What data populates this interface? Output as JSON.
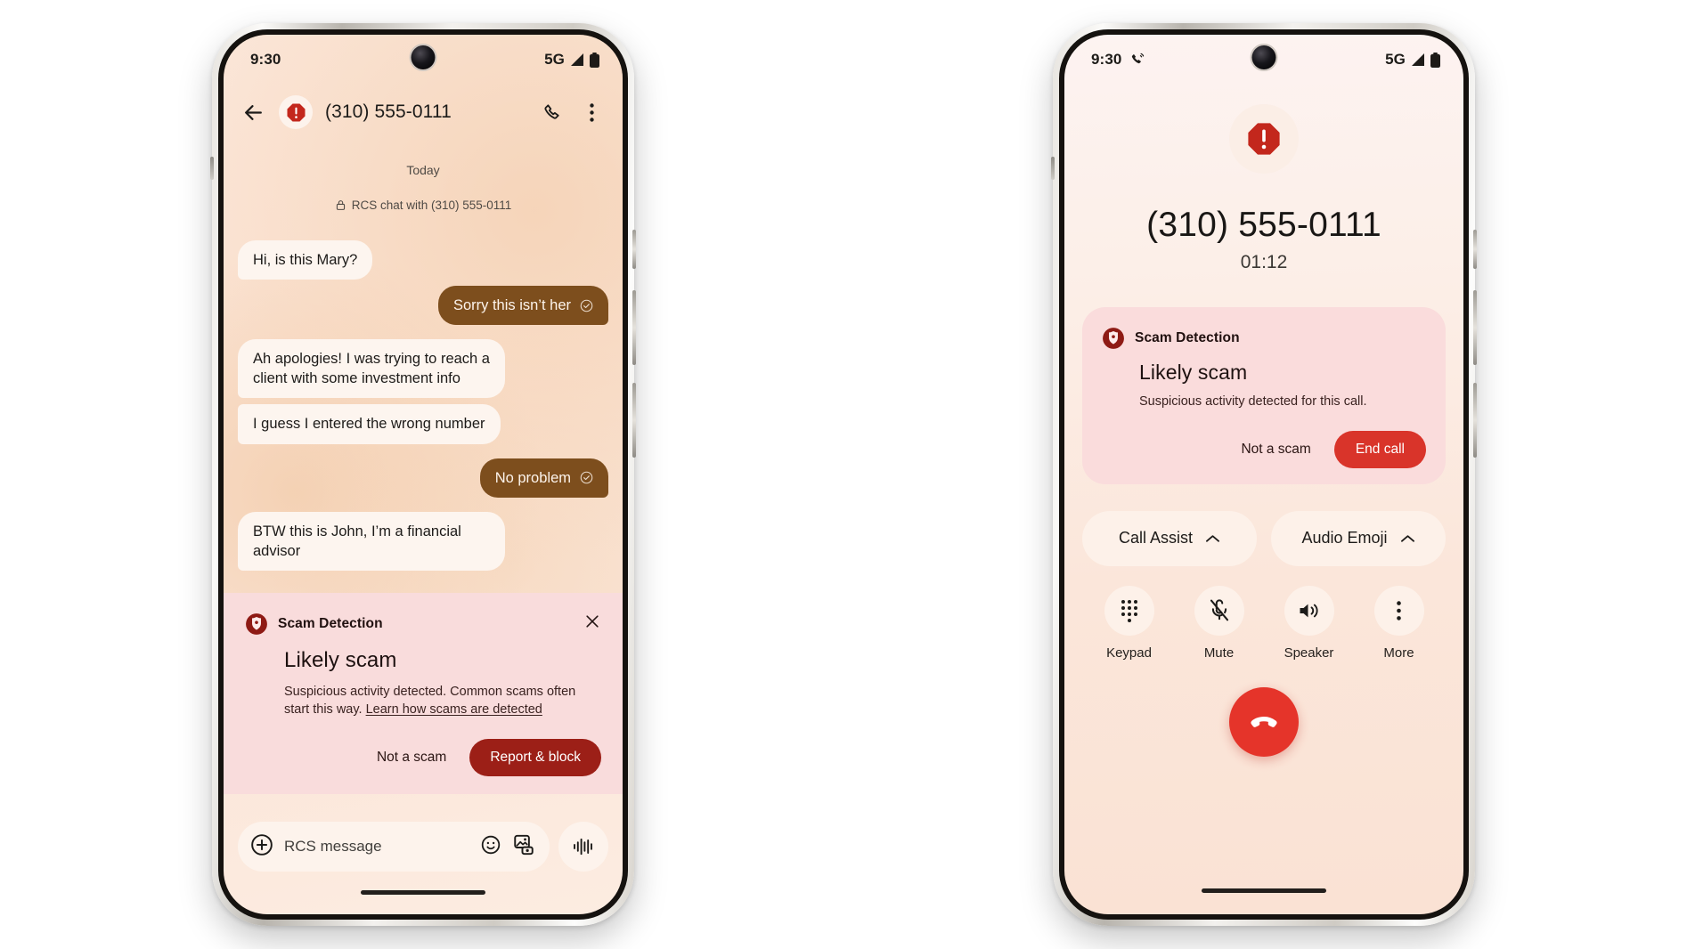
{
  "colors": {
    "scam_red": "#9c1f17",
    "end_call_red": "#d9342a",
    "hangup_red": "#e5342a",
    "outgoing_bubble": "#7d4e1d",
    "incoming_bubble": "#fdf5ef",
    "scam_card_bg": "#f9dcdc"
  },
  "phone_messages": {
    "status_bar": {
      "time": "9:30",
      "network": "5G",
      "signal_icon": "signal-bars-icon",
      "battery_icon": "battery-icon"
    },
    "app_bar": {
      "back_icon": "back-arrow-icon",
      "warning_icon": "scam-warning-icon",
      "title": "(310) 555-0111",
      "call_icon": "phone-icon",
      "overflow_icon": "more-vertical-icon"
    },
    "thread": {
      "day_label": "Today",
      "rcs_notice": "RCS chat with (310) 555-0111",
      "lock_icon": "lock-icon",
      "messages": [
        {
          "text": "Hi, is this Mary?",
          "side": "in"
        },
        {
          "text": "Sorry this isn’t her",
          "side": "out",
          "status_icon": "delivered-check-icon"
        },
        {
          "text": "Ah apologies! I was trying to reach a client with some investment info",
          "side": "in"
        },
        {
          "text": "I guess I entered the wrong number",
          "side": "in"
        },
        {
          "text": "No problem",
          "side": "out",
          "status_icon": "delivered-check-icon"
        },
        {
          "text": "BTW this is John, I’m a financial advisor",
          "side": "in"
        }
      ]
    },
    "scam_card": {
      "shield_icon": "scam-detection-shield-icon",
      "label": "Scam Detection",
      "close_icon": "close-icon",
      "title": "Likely scam",
      "body_prefix": "Suspicious activity detected. Common scams often start this way. ",
      "link_text": "Learn how scams are detected",
      "secondary_button": "Not a scam",
      "primary_button": "Report & block"
    },
    "compose": {
      "add_icon": "plus-circle-icon",
      "placeholder": "RCS message",
      "emoji_icon": "emoji-smiley-icon",
      "gallery_icon": "image-gallery-icon",
      "mic_icon": "voice-waveform-icon"
    }
  },
  "phone_call": {
    "status_bar": {
      "time": "9:30",
      "call_icon": "phone-in-call-icon",
      "network": "5G",
      "signal_icon": "signal-bars-icon",
      "battery_icon": "battery-icon"
    },
    "header": {
      "warning_icon": "scam-warning-icon",
      "number": "(310) 555-0111",
      "timer": "01:12"
    },
    "scam_card": {
      "shield_icon": "scam-detection-shield-icon",
      "label": "Scam Detection",
      "title": "Likely scam",
      "body": "Suspicious activity detected for this call.",
      "secondary_button": "Not a scam",
      "primary_button": "End call"
    },
    "assist_buttons": [
      {
        "label": "Call Assist",
        "chevron_icon": "chevron-up-icon"
      },
      {
        "label": "Audio Emoji",
        "chevron_icon": "chevron-up-icon"
      }
    ],
    "controls": [
      {
        "label": "Keypad",
        "icon": "dialpad-icon"
      },
      {
        "label": "Mute",
        "icon": "mic-off-icon"
      },
      {
        "label": "Speaker",
        "icon": "speaker-icon"
      },
      {
        "label": "More",
        "icon": "more-vertical-icon"
      }
    ],
    "hangup": {
      "icon": "hangup-phone-icon"
    }
  }
}
